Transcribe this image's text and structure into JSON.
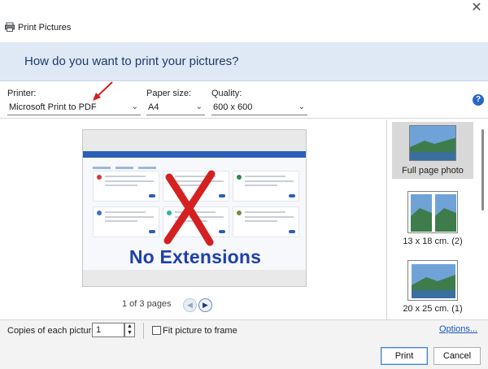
{
  "window": {
    "title": "Print Pictures",
    "close_glyph": "✕"
  },
  "banner": {
    "question": "How do you want to print your pictures?"
  },
  "printer": {
    "label": "Printer:",
    "value": "Microsoft Print to PDF"
  },
  "paper_size": {
    "label": "Paper size:",
    "value": "A4"
  },
  "quality": {
    "label": "Quality:",
    "value": "600 x 600"
  },
  "help": {
    "glyph": "?"
  },
  "preview": {
    "overlay_text": "No Extensions",
    "pager_text": "1 of 3 pages",
    "prev_glyph": "◀",
    "next_glyph": "▶"
  },
  "layouts": [
    {
      "label": "Full page photo"
    },
    {
      "label": "13 x 18 cm. (2)"
    },
    {
      "label": "20 x 25 cm. (1)"
    }
  ],
  "footer": {
    "copies_label": "Copies of each picture:",
    "copies_value": "1",
    "fit_label": "Fit picture to frame",
    "options_link": "Options...",
    "print_button": "Print",
    "cancel_button": "Cancel"
  },
  "colors": {
    "accent": "#2b5fb6",
    "annotation_red": "#d42020",
    "banner_bg": "#dfe9f5"
  }
}
